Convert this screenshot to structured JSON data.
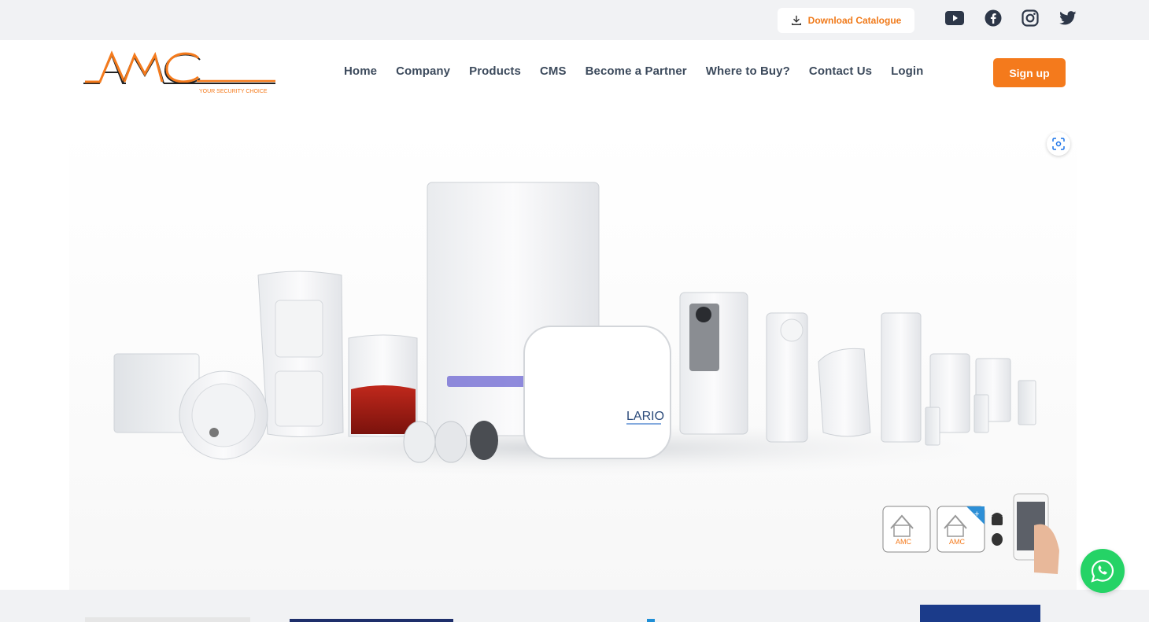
{
  "topbar": {
    "catalogue_label": "Download Catalogue",
    "social_icons": [
      "youtube-icon",
      "facebook-icon",
      "instagram-icon",
      "twitter-icon"
    ]
  },
  "header": {
    "logo_text": "AMC",
    "logo_tagline": "YOUR SECURITY CHOICE",
    "nav": [
      "Home",
      "Company",
      "Products",
      "CMS",
      "Become a Partner",
      "Where to Buy?",
      "Contact Us",
      "Login"
    ],
    "signup_label": "Sign up"
  },
  "hero": {
    "product_brand": "LARIO",
    "app_badge_text": "AMC"
  },
  "colors": {
    "accent": "#f47a1c",
    "nav_text": "#3c4a5c",
    "whatsapp": "#25d366"
  }
}
